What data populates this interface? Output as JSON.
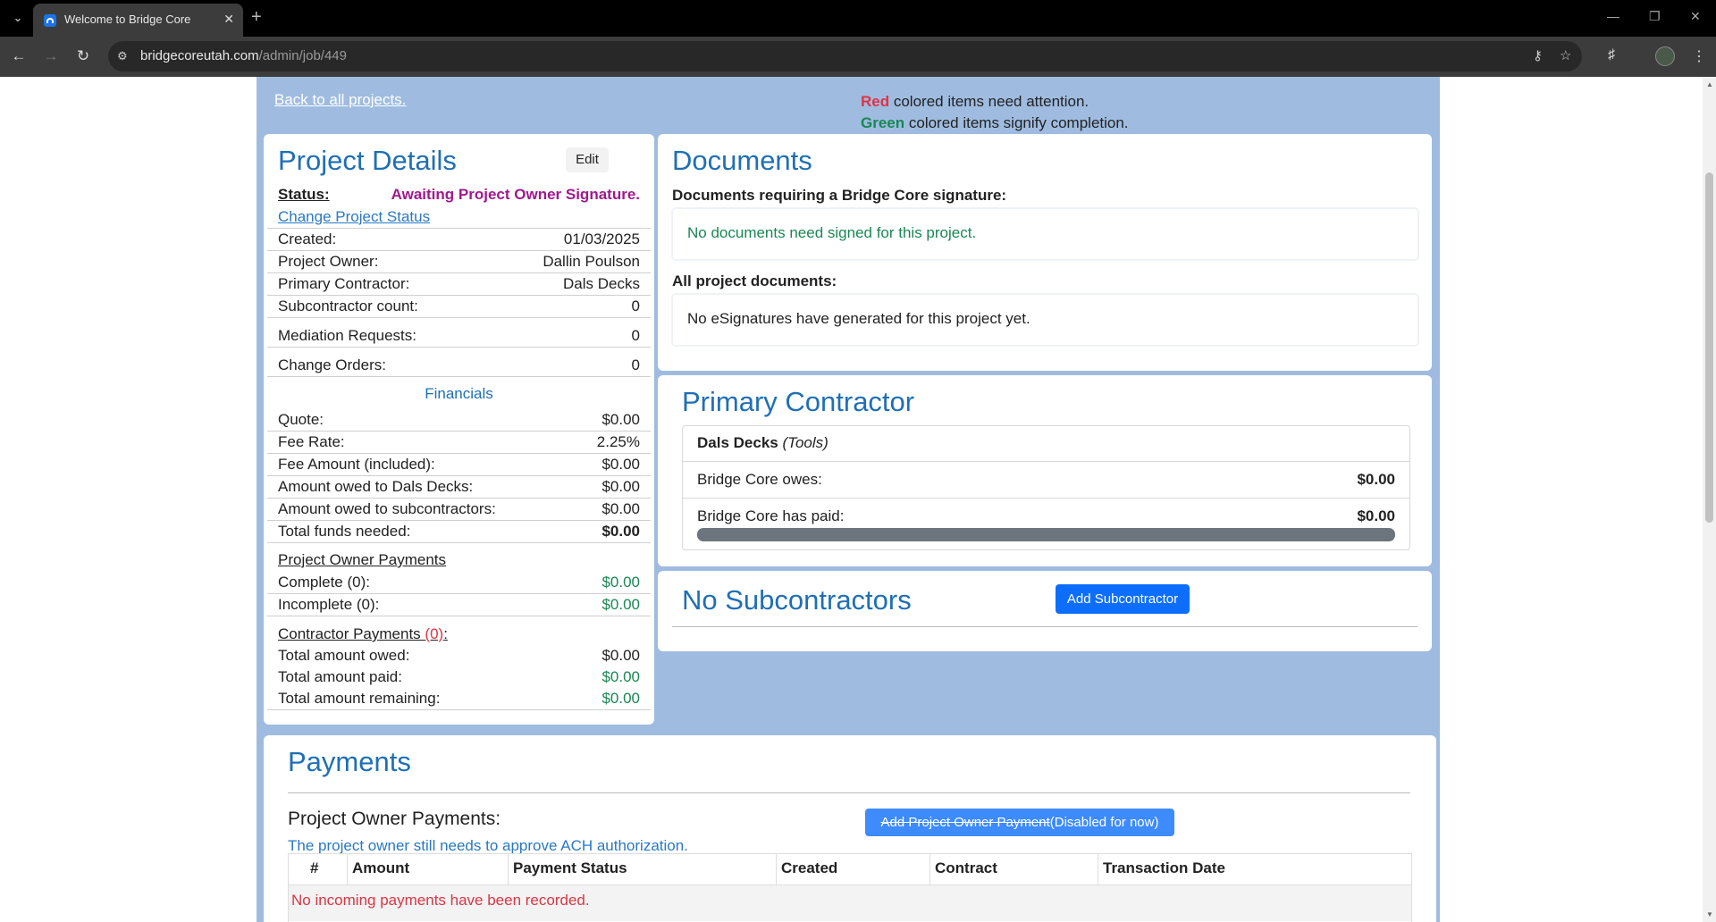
{
  "browser": {
    "tab_title": "Welcome to Bridge Core",
    "url_host": "bridgecoreutah.com",
    "url_path": "/admin/job/449"
  },
  "header": {
    "back_link": "Back to all projects.",
    "legend_red_word": "Red",
    "legend_red_text": " colored items need attention.",
    "legend_green_word": "Green",
    "legend_green_text": " colored items signify completion."
  },
  "project_details": {
    "title": "Project Details",
    "edit_label": "Edit",
    "status_label": "Status:",
    "status_value": "Awaiting Project Owner Signature.",
    "change_status_link": "Change Project Status",
    "rows": [
      {
        "label": "Created:",
        "value": "01/03/2025"
      },
      {
        "label": "Project Owner:",
        "value": "Dallin Poulson"
      },
      {
        "label": "Primary Contractor:",
        "value": "Dals Decks"
      },
      {
        "label": "Subcontractor count:",
        "value": "0"
      },
      {
        "label": "Mediation Requests:",
        "value": "0"
      },
      {
        "label": "Change Orders:",
        "value": "0"
      }
    ],
    "financials_heading": "Financials",
    "financials": [
      {
        "label": "Quote:",
        "value": "$0.00"
      },
      {
        "label": "Fee Rate:",
        "value": "2.25%"
      },
      {
        "label": "Fee Amount (included):",
        "value": "$0.00"
      },
      {
        "label": "Amount owed to Dals Decks:",
        "value": "$0.00"
      },
      {
        "label": "Amount owed to subcontractors:",
        "value": "$0.00"
      },
      {
        "label": "Total funds needed:",
        "value": "$0.00"
      }
    ],
    "owner_payments_heading": "Project Owner Payments",
    "owner_payments": [
      {
        "label": "Complete (0):",
        "value": "$0.00"
      },
      {
        "label": "Incomplete (0):",
        "value": "$0.00"
      }
    ],
    "contractor_payments_heading": "Contractor Payments ",
    "contractor_payments_count": "(0)",
    "contractor_payments_colon": ":",
    "contractor_payments": [
      {
        "label": "Total amount owed:",
        "value": "$0.00"
      },
      {
        "label": "Total amount paid:",
        "value": "$0.00"
      },
      {
        "label": "Total amount remaining:",
        "value": "$0.00"
      }
    ]
  },
  "documents": {
    "title": "Documents",
    "requiring_heading": "Documents requiring a Bridge Core signature:",
    "requiring_message": "No documents need signed for this project.",
    "all_heading": "All project documents:",
    "all_message": "No eSignatures have generated for this project yet."
  },
  "primary_contractor": {
    "title": "Primary Contractor",
    "name": "Dals Decks",
    "trade": "(Tools)",
    "owes_label": "Bridge Core owes:",
    "owes_value": "$0.00",
    "paid_label": "Bridge Core has paid:",
    "paid_value": "$0.00",
    "paid_progress_percent": 100
  },
  "subcontractors": {
    "title": "No Subcontractors",
    "add_label": "Add Subcontractor"
  },
  "payments": {
    "title": "Payments",
    "owner_heading": "Project Owner Payments:",
    "add_button_struck": "Add Project Owner Payment",
    "add_button_note": "(Disabled for now)",
    "ach_note": "The project owner still needs to approve ACH authorization.",
    "columns": [
      "#",
      "Amount",
      "Payment Status",
      "Created",
      "Contract",
      "Transaction Date"
    ],
    "empty_message": "No incoming payments have been recorded."
  },
  "colors": {
    "page_bg": "#9fbce0",
    "heading_blue": "#1f6fb5",
    "attention_red": "#dc3545",
    "complete_green": "#198754",
    "status_purple": "#a0188e",
    "button_blue": "#0d6efd"
  }
}
